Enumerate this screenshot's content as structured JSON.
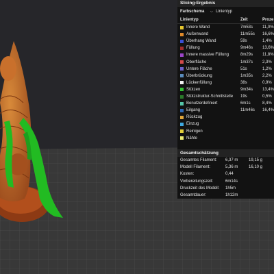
{
  "panel": {
    "title": "Slicing-Ergebnis",
    "scheme_label": "Farbschema",
    "scheme_value": "Linientyp",
    "columns": {
      "type": "Linientyp",
      "time": "Zeit",
      "percent": "Proze"
    },
    "rows": [
      {
        "name": "Innere Wand",
        "time": "7m53s",
        "pct": "11,0%",
        "color": "#e6c62e"
      },
      {
        "name": "Außenwand",
        "time": "11m55s",
        "pct": "16,6%",
        "color": "#e08a2a"
      },
      {
        "name": "Überhang Wand",
        "time": "59s",
        "pct": "1,4%",
        "color": "#3b4fd6"
      },
      {
        "name": "Füllung",
        "time": "9m46s",
        "pct": "13,6%",
        "color": "#a32c2c"
      },
      {
        "name": "Innere massive Füllung",
        "time": "8m29s",
        "pct": "11,8%",
        "color": "#9b46c8"
      },
      {
        "name": "Oberfläche",
        "time": "1m37s",
        "pct": "2,3%",
        "color": "#d24a4a"
      },
      {
        "name": "Untere Fläche",
        "time": "51s",
        "pct": "1,2%",
        "color": "#6e61c9"
      },
      {
        "name": "Überbrückung",
        "time": "1m35s",
        "pct": "2,2%",
        "color": "#5a8cbc"
      },
      {
        "name": "Lückenfüllung",
        "time": "38s",
        "pct": "0,9%",
        "color": "#f2f2f2"
      },
      {
        "name": "Stützen",
        "time": "9m34s",
        "pct": "13,4%",
        "color": "#33c233"
      },
      {
        "name": "Stützstruktur-Schnittstelle",
        "time": "19s",
        "pct": "0,5%",
        "color": "#2a7a2a"
      },
      {
        "name": "Benutzerdefiniert",
        "time": "6m1s",
        "pct": "8,4%",
        "color": "#55c6a8"
      },
      {
        "name": "Eilgang",
        "time": "11m46s",
        "pct": "16,4%",
        "color": "#2d69b8"
      },
      {
        "name": "Rückzug",
        "time": "",
        "pct": "",
        "color": "#e0a63a"
      },
      {
        "name": "Einzug",
        "time": "",
        "pct": "",
        "color": "#3fa9e0"
      },
      {
        "name": "Reinigen",
        "time": "",
        "pct": "",
        "color": "#e2cf3a"
      },
      {
        "name": "Nähte",
        "time": "",
        "pct": "",
        "color": "#ecec74"
      }
    ],
    "estimate_title": "Gesamtschätzung",
    "estimates": [
      {
        "label": "Gesamtes Filament:",
        "v1": "6,37 m",
        "v2": "19,15 g"
      },
      {
        "label": "Modell Filament:",
        "v1": "5,36 m",
        "v2": "16,10 g"
      },
      {
        "label": "Kosten:",
        "v1": "0,44",
        "v2": ""
      },
      {
        "label": "Vorbereitungszeit:",
        "v1": "6m14s",
        "v2": ""
      },
      {
        "label": "Druckzeit des Modell:",
        "v1": "1h5m",
        "v2": ""
      },
      {
        "label": "Gesamtdauer:",
        "v1": "1h12m",
        "v2": ""
      }
    ]
  },
  "colors": {
    "panel_bg": "#121212",
    "header_bg": "#232323",
    "viewport_bg": "#27272b",
    "bed": "#3c3c3c",
    "model": "#c9702c",
    "support": "#22bb22"
  },
  "icons": {
    "dropdown": "chevron-down-icon"
  }
}
